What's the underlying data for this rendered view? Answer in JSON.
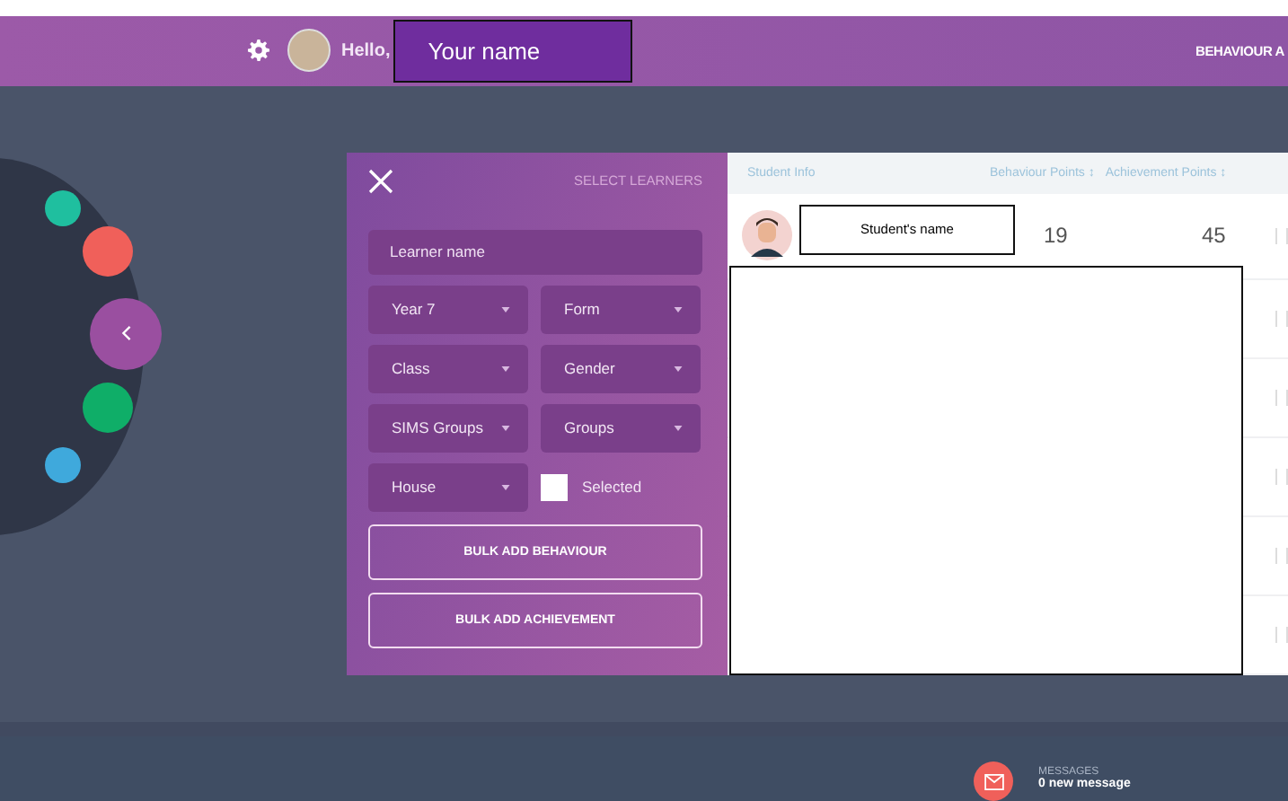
{
  "top_bar": {
    "greeting": "Hello,",
    "user_name": "Your name",
    "nav_label": "BEHAVIOUR A"
  },
  "side_dots": [
    {
      "color": "#1fbf9f"
    },
    {
      "color": "#f0605a"
    },
    {
      "color": "#0fae68"
    },
    {
      "color": "#3fa9dc"
    }
  ],
  "panel": {
    "title": "SELECT LEARNERS",
    "search": {
      "placeholder": "Learner name"
    },
    "filters": [
      {
        "kind": "dropdown",
        "label": "Year 7"
      },
      {
        "kind": "dropdown",
        "label": "Form"
      },
      {
        "kind": "dropdown",
        "label": "Class"
      },
      {
        "kind": "dropdown",
        "label": "Gender"
      },
      {
        "kind": "dropdown",
        "label": "SIMS Groups"
      },
      {
        "kind": "dropdown",
        "label": "Groups"
      },
      {
        "kind": "dropdown",
        "label": "House"
      },
      {
        "kind": "checkbox",
        "label": "Selected",
        "checked": false
      }
    ],
    "buttons": [
      "BULK ADD BEHAVIOUR",
      "BULK ADD ACHIEVEMENT"
    ]
  },
  "table": {
    "columns": [
      "Student Info",
      "Behaviour Points ↕",
      "Achievement Points ↕"
    ],
    "rows": [
      {
        "name": "Student's  name",
        "behaviour": "19",
        "achievement": "45"
      }
    ]
  },
  "messages": {
    "label": "MESSAGES",
    "count_text": "0 new message"
  }
}
